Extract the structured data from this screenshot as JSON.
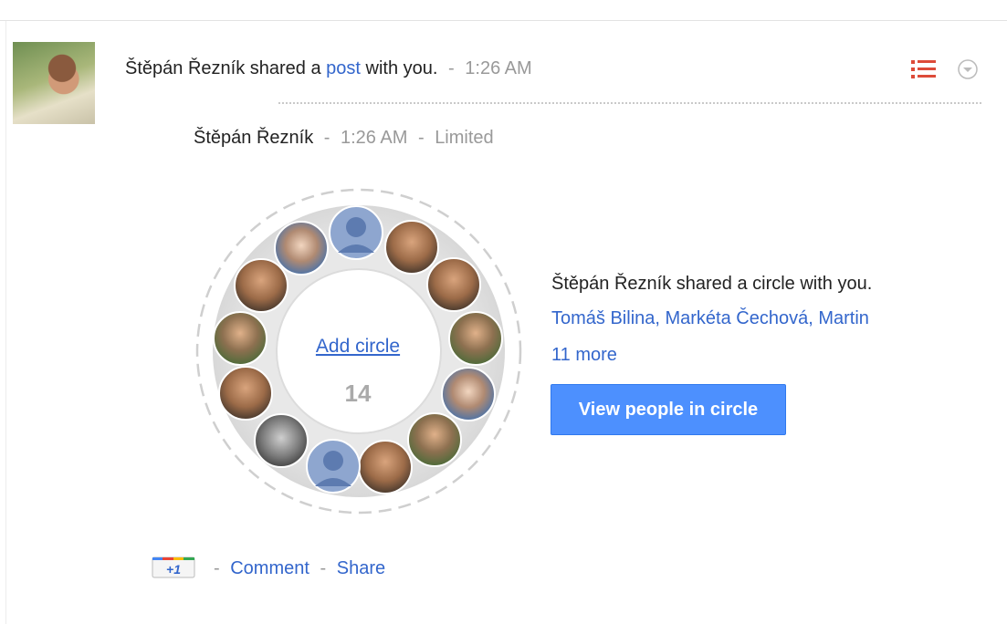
{
  "post": {
    "author": "Štěpán Řezník",
    "shared_text": "shared a",
    "post_link": "post",
    "with_you": "with you.",
    "separator": "-",
    "time": "1:26 AM"
  },
  "sub": {
    "author": "Štěpán Řezník",
    "time": "1:26 AM",
    "visibility": "Limited",
    "separator": "-"
  },
  "circle": {
    "add_label": "Add circle",
    "count": "14",
    "description": "Štěpán Řezník shared a circle with you.",
    "names": "Tomáš Bilina, Markéta Čechová, Martin",
    "more": "11 more",
    "view_button": "View people in circle"
  },
  "actions": {
    "plusone": "+1",
    "comment": "Comment",
    "share": "Share",
    "separator": "-"
  },
  "colors": {
    "link": "#3366cc",
    "button": "#4d90fe",
    "menu_icon": "#dd4b39"
  },
  "icons": [
    "list-menu-icon",
    "chevron-down-icon",
    "plus-one-icon"
  ]
}
